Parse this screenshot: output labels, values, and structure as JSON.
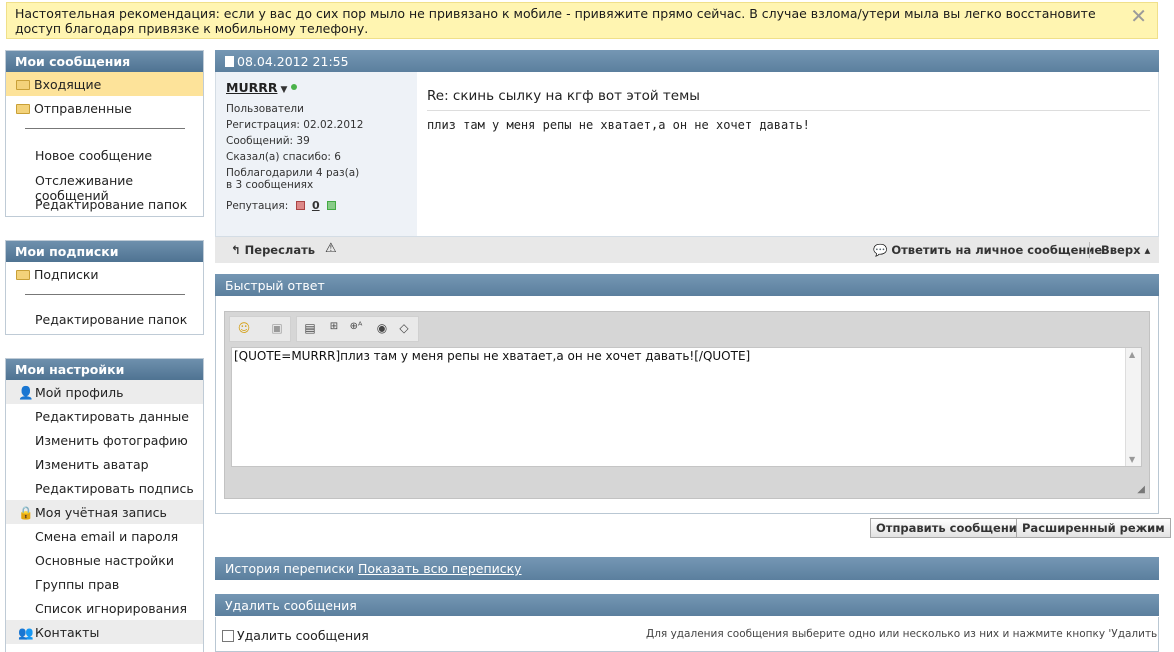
{
  "notice": {
    "text": "Настоятельная рекомендация: если у вас до сих пор мыло не привязано к мобиле - привяжите прямо сейчас. В случае взлома/утери мыла вы легко восстановите доступ благодаря привязке к мобильному телефону.",
    "close": "✕"
  },
  "messages_block": {
    "title": "Мои сообщения",
    "inbox": "Входящие",
    "sent": "Отправленные",
    "new_message": "Новое сообщение",
    "tracking": "Отслеживание сообщений",
    "edit_folders": "Редактирование папок"
  },
  "subs_block": {
    "title": "Мои подписки",
    "subs": "Подписки",
    "edit_folders": "Редактирование папок"
  },
  "settings_block": {
    "title": "Мои настройки",
    "profile": "Мой профиль",
    "edit_data": "Редактировать данные",
    "change_photo": "Изменить фотографию",
    "change_avatar": "Изменить аватар",
    "edit_signature": "Редактировать подпись",
    "account": "Моя учётная запись",
    "email_password": "Смена email и пароля",
    "main_settings": "Основные настройки",
    "groups": "Группы прав",
    "ignore_list": "Список игнорирования",
    "contacts": "Контакты"
  },
  "post": {
    "date": "08.04.2012 21:55",
    "username": "MURRR",
    "group": "Пользователи",
    "registration": "Регистрация:   02.02.2012",
    "messages": "Сообщений:   39",
    "thanks_said": "Сказал(а) спасибо:   6",
    "thanked_1": "Поблагодарили 4 раз(а)",
    "thanked_2": "в 3 сообщениях",
    "reputation_label": "Репутация:",
    "reputation_value": "0",
    "title": "Re: скинь сылку на кгф вот этой темы",
    "text": "плиз там у меня репы не хватает,а он не хочет давать!"
  },
  "actions": {
    "forward": "Переслать",
    "reply": "Ответить на личное сообщение",
    "top": "Вверх ▴"
  },
  "quick_reply": {
    "title": "Быстрый ответ",
    "text": "[QUOTE=MURRR]плиз там у меня репы не хватает,а он не хочет давать![/QUOTE]",
    "send": "Отправить сообщение",
    "advanced": "Расширенный режим"
  },
  "history": {
    "label": "История переписки",
    "link": "Показать всю переписку"
  },
  "delete": {
    "title": "Удалить сообщения",
    "checkbox": "Удалить сообщения",
    "hint": "Для удаления сообщения выберите одно или несколько из них и нажмите кнопку 'Удалить"
  }
}
